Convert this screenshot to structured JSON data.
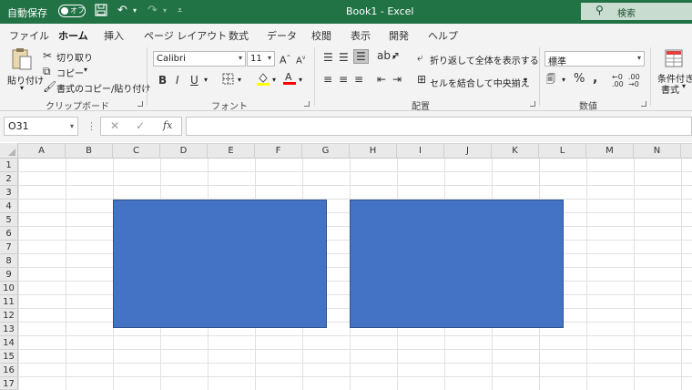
{
  "titlebar": {
    "autosave_label": "自動保存",
    "autosave_state": "オフ",
    "doc_title": "Book1  -  Excel",
    "search_label": "検索"
  },
  "tabs": [
    "ファイル",
    "ホーム",
    "挿入",
    "ページ レイアウト",
    "数式",
    "データ",
    "校閲",
    "表示",
    "開発",
    "ヘルプ"
  ],
  "active_tab": "ホーム",
  "ribbon": {
    "clipboard": {
      "paste_label": "貼り付け",
      "cut_label": "切り取り",
      "copy_label": "コピー",
      "format_painter_label": "書式のコピー/貼り付け",
      "group_label": "クリップボード"
    },
    "font": {
      "font_name": "Calibri",
      "font_size": "11",
      "group_label": "フォント",
      "fill_color": "#ffff00",
      "font_color": "#ff0000"
    },
    "alignment": {
      "wrap_text_label": "折り返して全体を表示する",
      "merge_center_label": "セルを結合して中央揃え",
      "group_label": "配置"
    },
    "number": {
      "format_value": "標準",
      "group_label": "数値"
    },
    "styles": {
      "conditional_label_1": "条件付き",
      "conditional_label_2": "書式"
    }
  },
  "formula_bar": {
    "name_box": "O31",
    "fx_label": "fx",
    "formula_value": ""
  },
  "columns": [
    "A",
    "B",
    "C",
    "D",
    "E",
    "F",
    "G",
    "H",
    "I",
    "J",
    "K",
    "L",
    "M",
    "N"
  ],
  "rows": [
    "1",
    "2",
    "3",
    "4",
    "5",
    "6",
    "7",
    "8",
    "9",
    "10",
    "11",
    "12",
    "13",
    "14",
    "15",
    "16",
    "17"
  ],
  "shapes_fill_color": "#4472c4",
  "accent_color": "#217346"
}
